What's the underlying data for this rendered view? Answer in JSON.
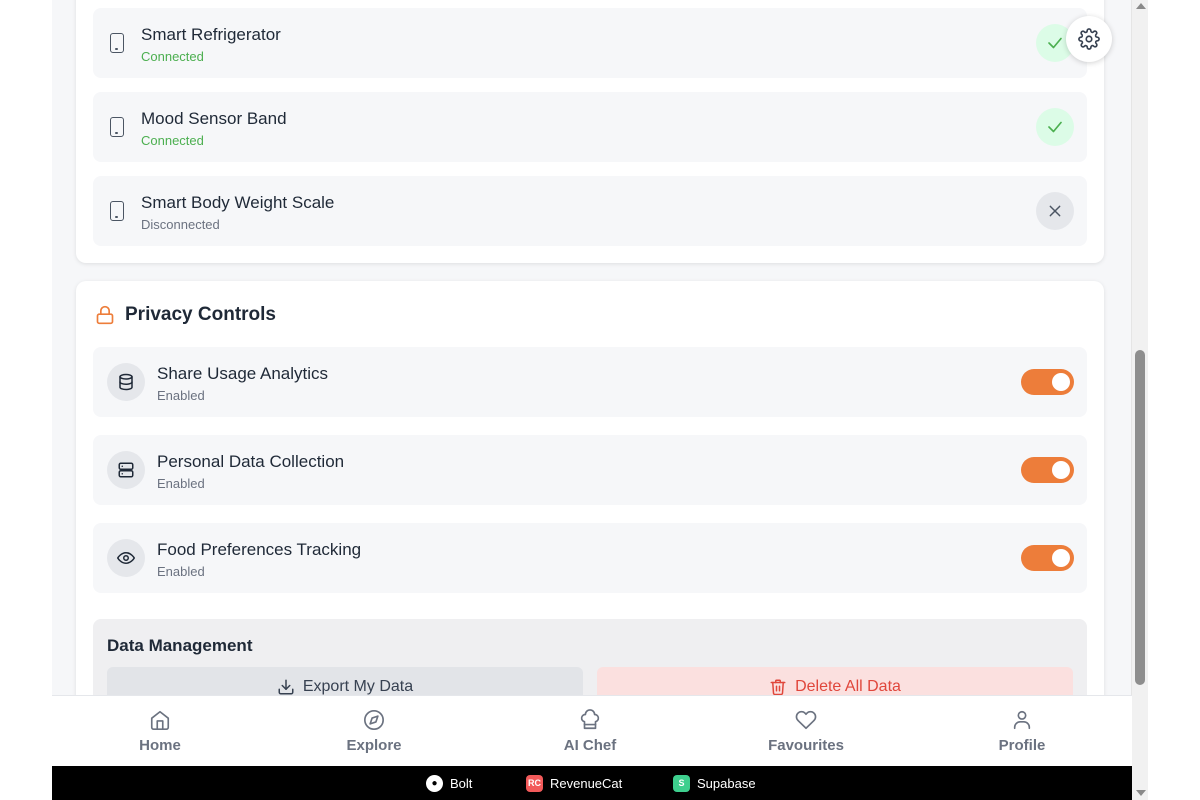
{
  "devices": [
    {
      "name": "Smart Refrigerator",
      "status": "Connected",
      "connected": true
    },
    {
      "name": "Mood Sensor Band",
      "status": "Connected",
      "connected": true
    },
    {
      "name": "Smart Body Weight Scale",
      "status": "Disconnected",
      "connected": false
    }
  ],
  "privacy": {
    "title": "Privacy Controls",
    "items": [
      {
        "label": "Share Usage Analytics",
        "status": "Enabled",
        "icon": "database-icon",
        "on": true
      },
      {
        "label": "Personal Data Collection",
        "status": "Enabled",
        "icon": "server-icon",
        "on": true
      },
      {
        "label": "Food Preferences Tracking",
        "status": "Enabled",
        "icon": "eye-icon",
        "on": true
      }
    ]
  },
  "data_management": {
    "title": "Data Management",
    "export_label": "Export My Data",
    "delete_label": "Delete All Data"
  },
  "nav": [
    {
      "label": "Home",
      "icon": "home-icon"
    },
    {
      "label": "Explore",
      "icon": "compass-icon"
    },
    {
      "label": "AI Chef",
      "icon": "chef-hat-icon"
    },
    {
      "label": "Favourites",
      "icon": "heart-icon"
    },
    {
      "label": "Profile",
      "icon": "user-icon"
    }
  ],
  "footer": {
    "bolt": "Bolt",
    "revenuecat": "RevenueCat",
    "revenuecat_logo": "RC",
    "supabase": "Supabase",
    "supabase_logo": "S"
  },
  "colors": {
    "accent": "#ed7d3a",
    "connected": "#4caf50",
    "danger": "#e0463b"
  }
}
